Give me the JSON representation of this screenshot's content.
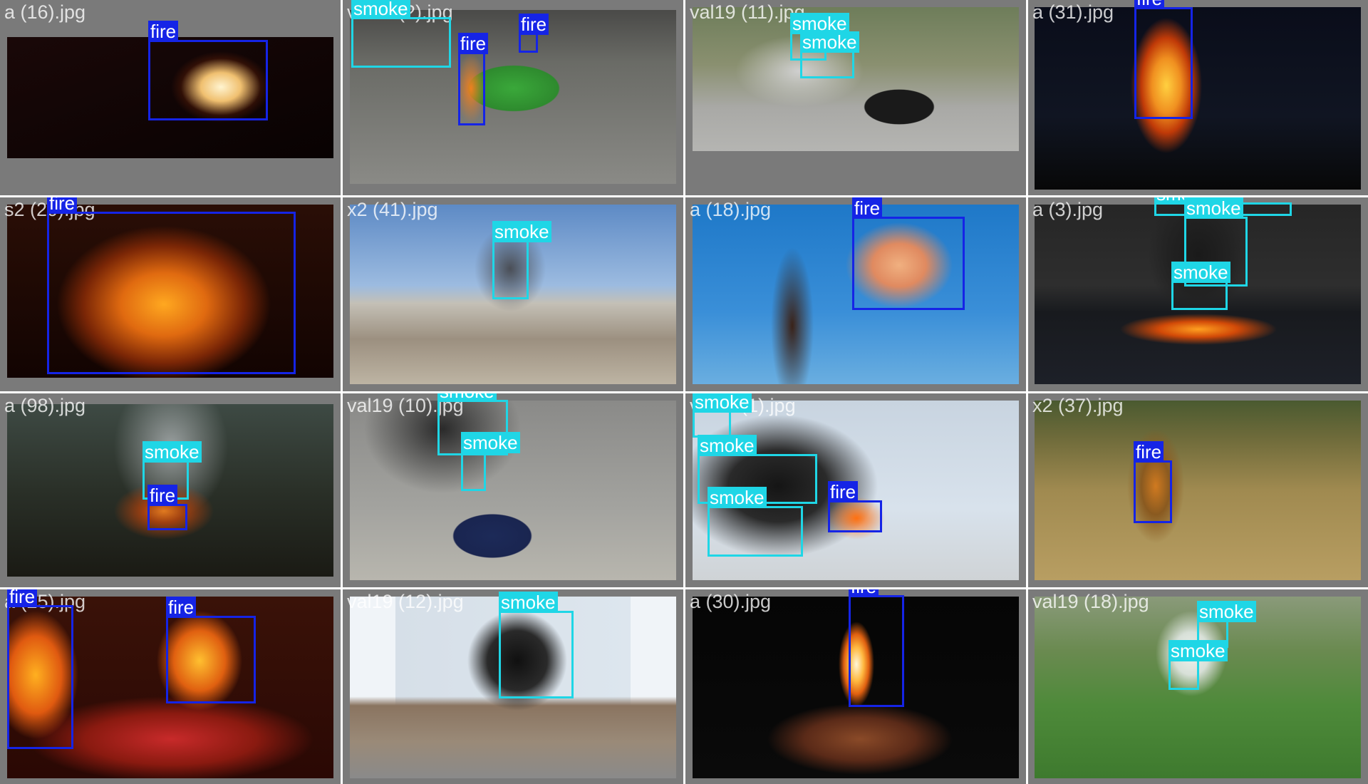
{
  "tiles": [
    {
      "filename": "a (16).jpg",
      "labels": [
        "fire"
      ]
    },
    {
      "filename": "val19 (2).jpg",
      "labels": [
        "smoke",
        "fire",
        "fire"
      ]
    },
    {
      "filename": "val19 (11).jpg",
      "labels": [
        "smoke",
        "smoke"
      ]
    },
    {
      "filename": "a (31).jpg",
      "labels": [
        "fire"
      ]
    },
    {
      "filename": "s2 (20).jpg",
      "labels": [
        "fire"
      ]
    },
    {
      "filename": "x2 (41).jpg",
      "labels": [
        "smoke"
      ]
    },
    {
      "filename": "a (18).jpg",
      "labels": [
        "fire"
      ]
    },
    {
      "filename": "a (3).jpg",
      "labels": [
        "smoke",
        "smoke",
        "smoke"
      ]
    },
    {
      "filename": "a (98).jpg",
      "labels": [
        "smoke",
        "fire"
      ]
    },
    {
      "filename": "val19 (10).jpg",
      "labels": [
        "smoke",
        "smoke"
      ]
    },
    {
      "filename": "val19 (1).jpg",
      "labels": [
        "smoke",
        "smoke",
        "smoke",
        "fire"
      ]
    },
    {
      "filename": "x2 (37).jpg",
      "labels": [
        "fire"
      ]
    },
    {
      "filename": "a (25).jpg",
      "labels": [
        "fire",
        "fire"
      ]
    },
    {
      "filename": "val19 (12).jpg",
      "labels": [
        "smoke"
      ]
    },
    {
      "filename": "a (30).jpg",
      "labels": [
        "fire"
      ]
    },
    {
      "filename": "val19 (18).jpg",
      "labels": [
        "smoke",
        "smoke"
      ]
    }
  ],
  "colors": {
    "fire": "#1524e6",
    "smoke": "#1fd6e6",
    "tile_border": "#7a7a7a"
  }
}
